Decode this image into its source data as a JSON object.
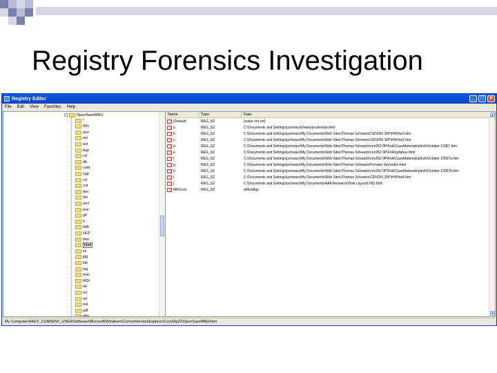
{
  "slide": {
    "title": "Registry Forensics Investigation",
    "accent_colors": [
      "#7a7fa8",
      "#b7bbd4",
      "#d6d8e6"
    ]
  },
  "window": {
    "title": "Registry Editor",
    "buttons": {
      "minimize": "_",
      "maximize": "□",
      "close": "✕"
    },
    "menu": [
      "File",
      "Edit",
      "View",
      "Favorites",
      "Help"
    ],
    "status": "My Computer\\HKEY_CURRENT_USER\\Software\\Microsoft\\Windows\\CurrentVersion\\Explorer\\ComDlg32\\OpenSaveMRU\\htm"
  },
  "tree": {
    "root": "OpenSaveMRU",
    "items": [
      "*",
      "001",
      "aux",
      "avi",
      "avt",
      "bup",
      "cd",
      "db",
      "cont",
      "cpp",
      "crt",
      "cut",
      "doc",
      "dvi",
      "eml",
      "exe",
      "gif",
      "h",
      "hdb",
      "HLP",
      "htm",
      "html",
      "ini",
      "jpg",
      "lnk",
      "log",
      "msc",
      "MDI",
      "nk",
      "nrt",
      "nrl",
      "out",
      "pdf",
      "php"
    ],
    "selected": "html"
  },
  "list": {
    "headers": {
      "name": "Name",
      "type": "Type",
      "data": "Data"
    },
    "rows": [
      {
        "name": "(Default)",
        "type": "REG_SZ",
        "data": "(value not set)"
      },
      {
        "name": "a",
        "type": "REG_SZ",
        "data": "C:\\Documents and Settings\\jschwarz\\Desktop\\calendar.html"
      },
      {
        "name": "b",
        "type": "REG_SZ",
        "data": "C:\\Documents and Settings\\jschwarz\\My Documents\\Web Sites\\Thomas Schwartz\\CEN250 30P\\HW\\hw3.htm"
      },
      {
        "name": "c",
        "type": "REG_SZ",
        "data": "C:\\Documents and Settings\\jschwarz\\My Documents\\Web Sites\\Thomas Schwartz\\CEN250 30P\\HW\\hw2.htm"
      },
      {
        "name": "d",
        "type": "REG_SZ",
        "data": "C:\\Documents and Settings\\jschwarz\\My Documents\\Web Sites\\Thomas Schwartz\\cen252 0P\\Folk\\CaseMaterials\\phish\\October 12007.htm"
      },
      {
        "name": "e",
        "type": "REG_SZ",
        "data": "C:\\Documents and Settings\\jschwarz\\My Documents\\Web Sites\\Thomas Schwartz\\cen252 0P\\Folk\\syllabus.html"
      },
      {
        "name": "f",
        "type": "REG_SZ",
        "data": "C:\\Documents and Settings\\jschwarz\\My Documents\\Web Sites\\Thomas Schwartz\\cen252 0P\\Folk\\CaseMaterials\\phish\\October 12007a.htm"
      },
      {
        "name": "g",
        "type": "REG_SZ",
        "data": "C:\\Documents and Settings\\jschwarz\\My Documents\\Web Sites\\Thomas Schwartz\\Preview Sex\\index.html"
      },
      {
        "name": "h",
        "type": "REG_SZ",
        "data": "C:\\Documents and Settings\\jschwarz\\My Documents\\Web Sites\\Thomas Schwartz\\cen252 0P\\Folk\\CaseMaterials\\phish\\October 12007b.htm"
      },
      {
        "name": "i",
        "type": "REG_SZ",
        "data": "C:\\Documents and Settings\\jschwarz\\My Documents\\Web Sites\\Thomas Schwartz\\CEN250 30P\\HW\\hw4.htm"
      },
      {
        "name": "j",
        "type": "REG_SZ",
        "data": "C:\\Documents and Settings\\jschwarz\\My Documents\\AAA Research\\Disk Layout\\LINS.html"
      },
      {
        "name": "MRUList",
        "type": "REG_SZ",
        "data": "ahfcedbgi"
      }
    ]
  }
}
